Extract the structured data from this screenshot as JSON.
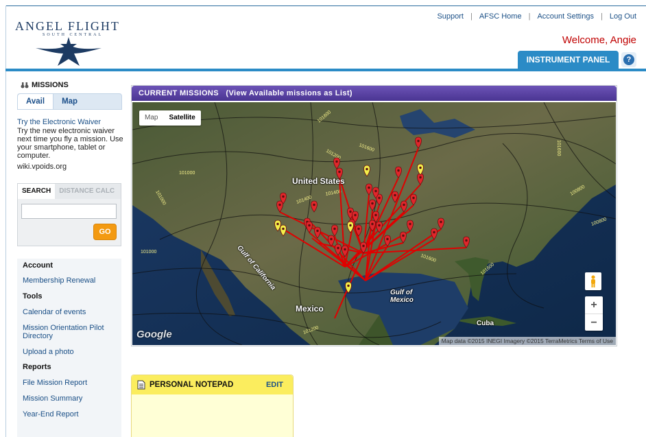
{
  "brand": {
    "title": "ANGEL FLIGHT",
    "subtitle": "SOUTH CENTRAL",
    "logo_color": "#1d3b63"
  },
  "topnav": {
    "support": "Support",
    "afsc_home": "AFSC Home",
    "account_settings": "Account Settings",
    "log_out": "Log Out",
    "separator": "|"
  },
  "welcome": "Welcome, Angie",
  "instrument_panel_tab": "INSTRUMENT PANEL",
  "help_label": "?",
  "sidebar": {
    "missions_title": "MISSIONS",
    "mission_tabs": [
      "Avail",
      "Map"
    ],
    "waiver_link": "Try the Electronic Waiver",
    "waiver_text": "Try the new electronic waiver next time you fly a mission. Use your smartphone, tablet or computer.",
    "wiki": "wiki.vpoids.org",
    "search": {
      "tab_search": "SEARCH",
      "tab_distance": "DISTANCE CALC",
      "input_value": "",
      "go_label": "GO"
    },
    "menu": [
      {
        "label": "Account",
        "type": "head"
      },
      {
        "label": "Membership Renewal",
        "type": "link"
      },
      {
        "label": "Tools",
        "type": "head"
      },
      {
        "label": "Calendar of events",
        "type": "link"
      },
      {
        "label": "Mission Orientation Pilot Directory",
        "type": "link"
      },
      {
        "label": "Upload a photo",
        "type": "link"
      },
      {
        "label": "Reports",
        "type": "head"
      },
      {
        "label": "File Mission Report",
        "type": "link"
      },
      {
        "label": "Mission Summary",
        "type": "link"
      },
      {
        "label": "Year-End Report",
        "type": "link"
      }
    ]
  },
  "map_panel": {
    "title": "CURRENT MISSIONS",
    "list_link": "(View Available missions as List)",
    "map_type_map": "Map",
    "map_type_satellite": "Satellite",
    "labels": {
      "us": "United States",
      "mexico": "Mexico",
      "gulf_california": "Gulf of California",
      "gulf_mexico": "Gulf of Mexico",
      "cuba": "Cuba"
    },
    "isobars": [
      "101600",
      "101200",
      "101600",
      "101000",
      "101000",
      "101000",
      "101400",
      "101400",
      "101600",
      "101600",
      "100800",
      "100800"
    ],
    "google": "Google",
    "attribution": "Map data ©2015 INEGI Imagery ©2015 TerraMetrics   Terms of Use",
    "zoom_in": "+",
    "zoom_out": "−",
    "marker_colors": {
      "red": "#e0262b",
      "yellow": "#f3ef4a",
      "route": "#e00000"
    }
  },
  "notepad": {
    "title": "PERSONAL NOTEPAD",
    "edit": "EDIT"
  }
}
